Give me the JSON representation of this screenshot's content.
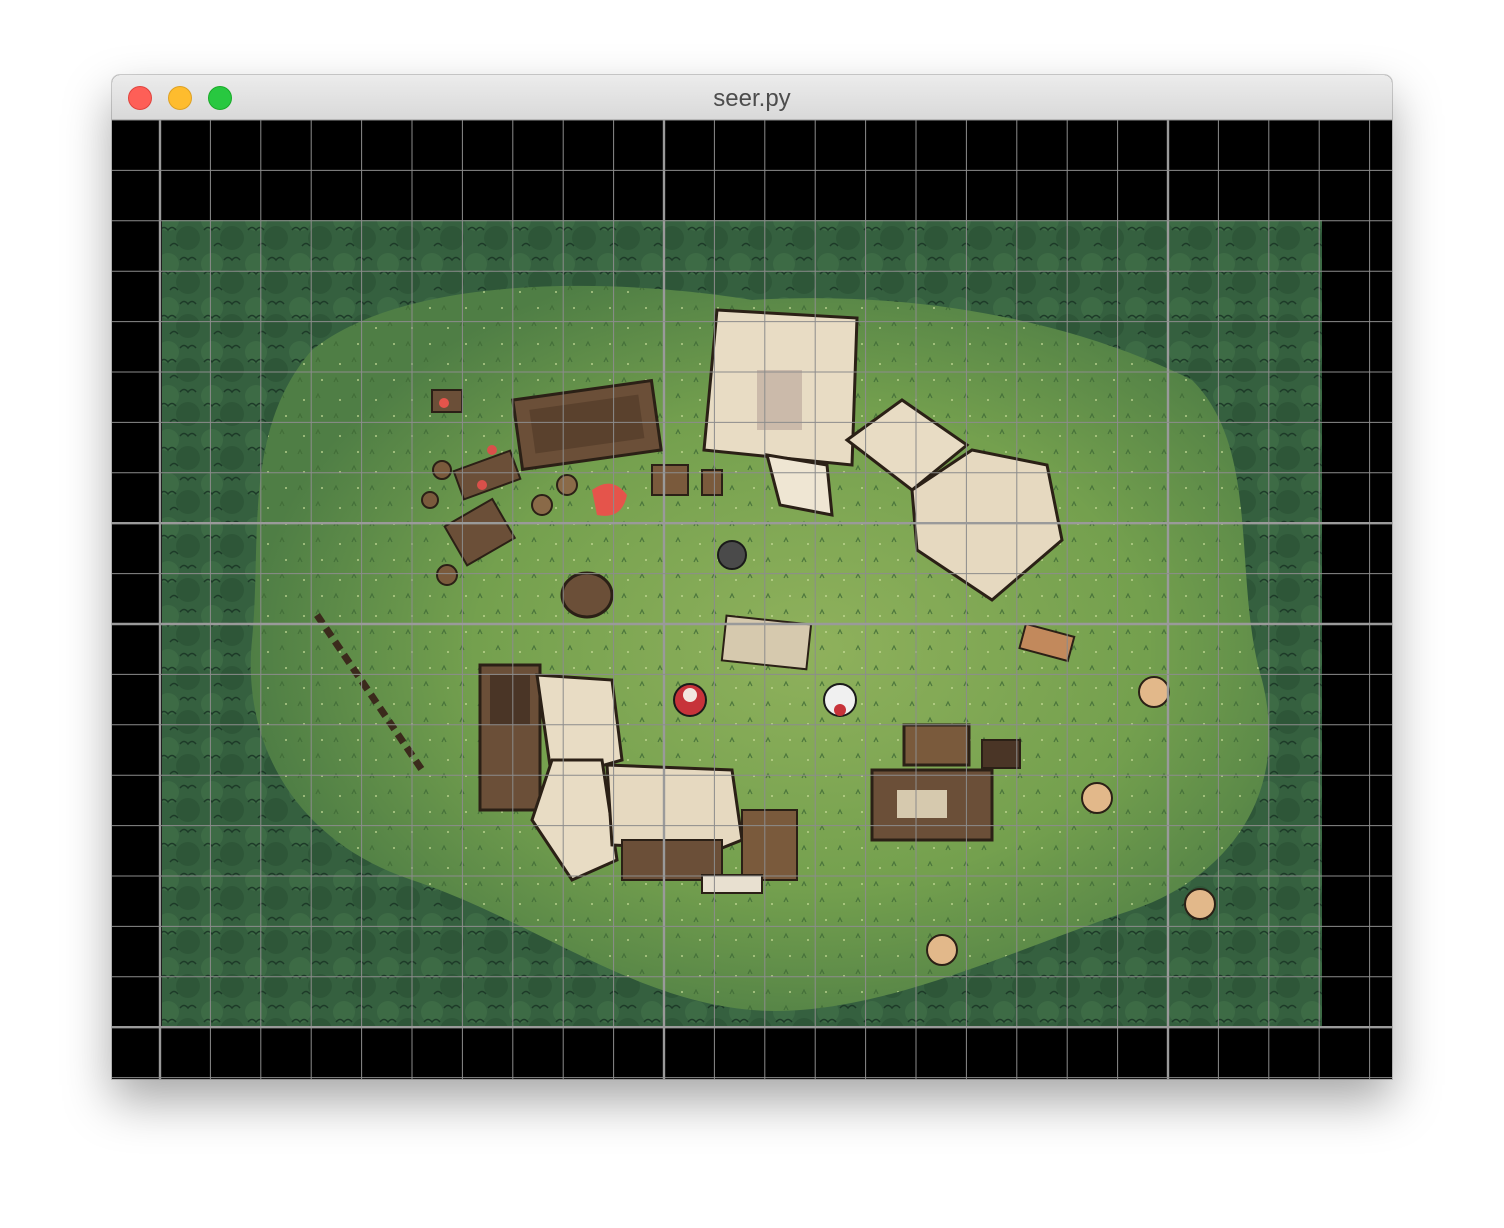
{
  "window": {
    "title": "seer.py"
  },
  "map": {
    "grid_color": "#8c8c8c",
    "grid_major_color": "#9a9a9a",
    "background_color": "#000000",
    "grass_color": "#6f9a4c",
    "forest_color": "#2f5a3c"
  },
  "tokens": [
    {
      "name": "red-hooded-character-icon"
    },
    {
      "name": "white-hooded-character-icon"
    }
  ]
}
